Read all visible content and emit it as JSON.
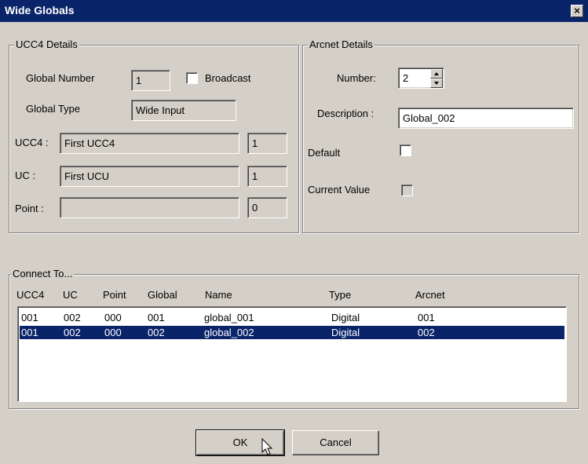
{
  "window": {
    "title": "Wide Globals",
    "close_glyph": "×"
  },
  "ucc4": {
    "legend": "UCC4 Details",
    "global_number_label": "Global Number",
    "global_number": "1",
    "broadcast_label": "Broadcast",
    "global_type_label": "Global Type",
    "global_type": "Wide Input",
    "ucc4_label": "UCC4 :",
    "ucc4_value": "First UCC4",
    "ucc4_num": "1",
    "uc_label": "UC :",
    "uc_value": "First UCU",
    "uc_num": "1",
    "point_label": "Point :",
    "point_value": "",
    "point_num": "0"
  },
  "arcnet": {
    "legend": "Arcnet Details",
    "number_label": "Number:",
    "number": "2",
    "description_label": "Description :",
    "description": "Global_002",
    "default_label": "Default",
    "current_value_label": "Current Value"
  },
  "connect": {
    "legend": "Connect To...",
    "columns": [
      "UCC4",
      "UC",
      "Point",
      "Global",
      "Name",
      "Type",
      "Arcnet"
    ],
    "rows": [
      [
        "001",
        "002",
        "000",
        "001",
        "global_001",
        "Digital",
        "001"
      ],
      [
        "001",
        "002",
        "000",
        "002",
        "global_002",
        "Digital",
        "002"
      ]
    ]
  },
  "buttons": {
    "ok": "OK",
    "cancel": "Cancel"
  }
}
